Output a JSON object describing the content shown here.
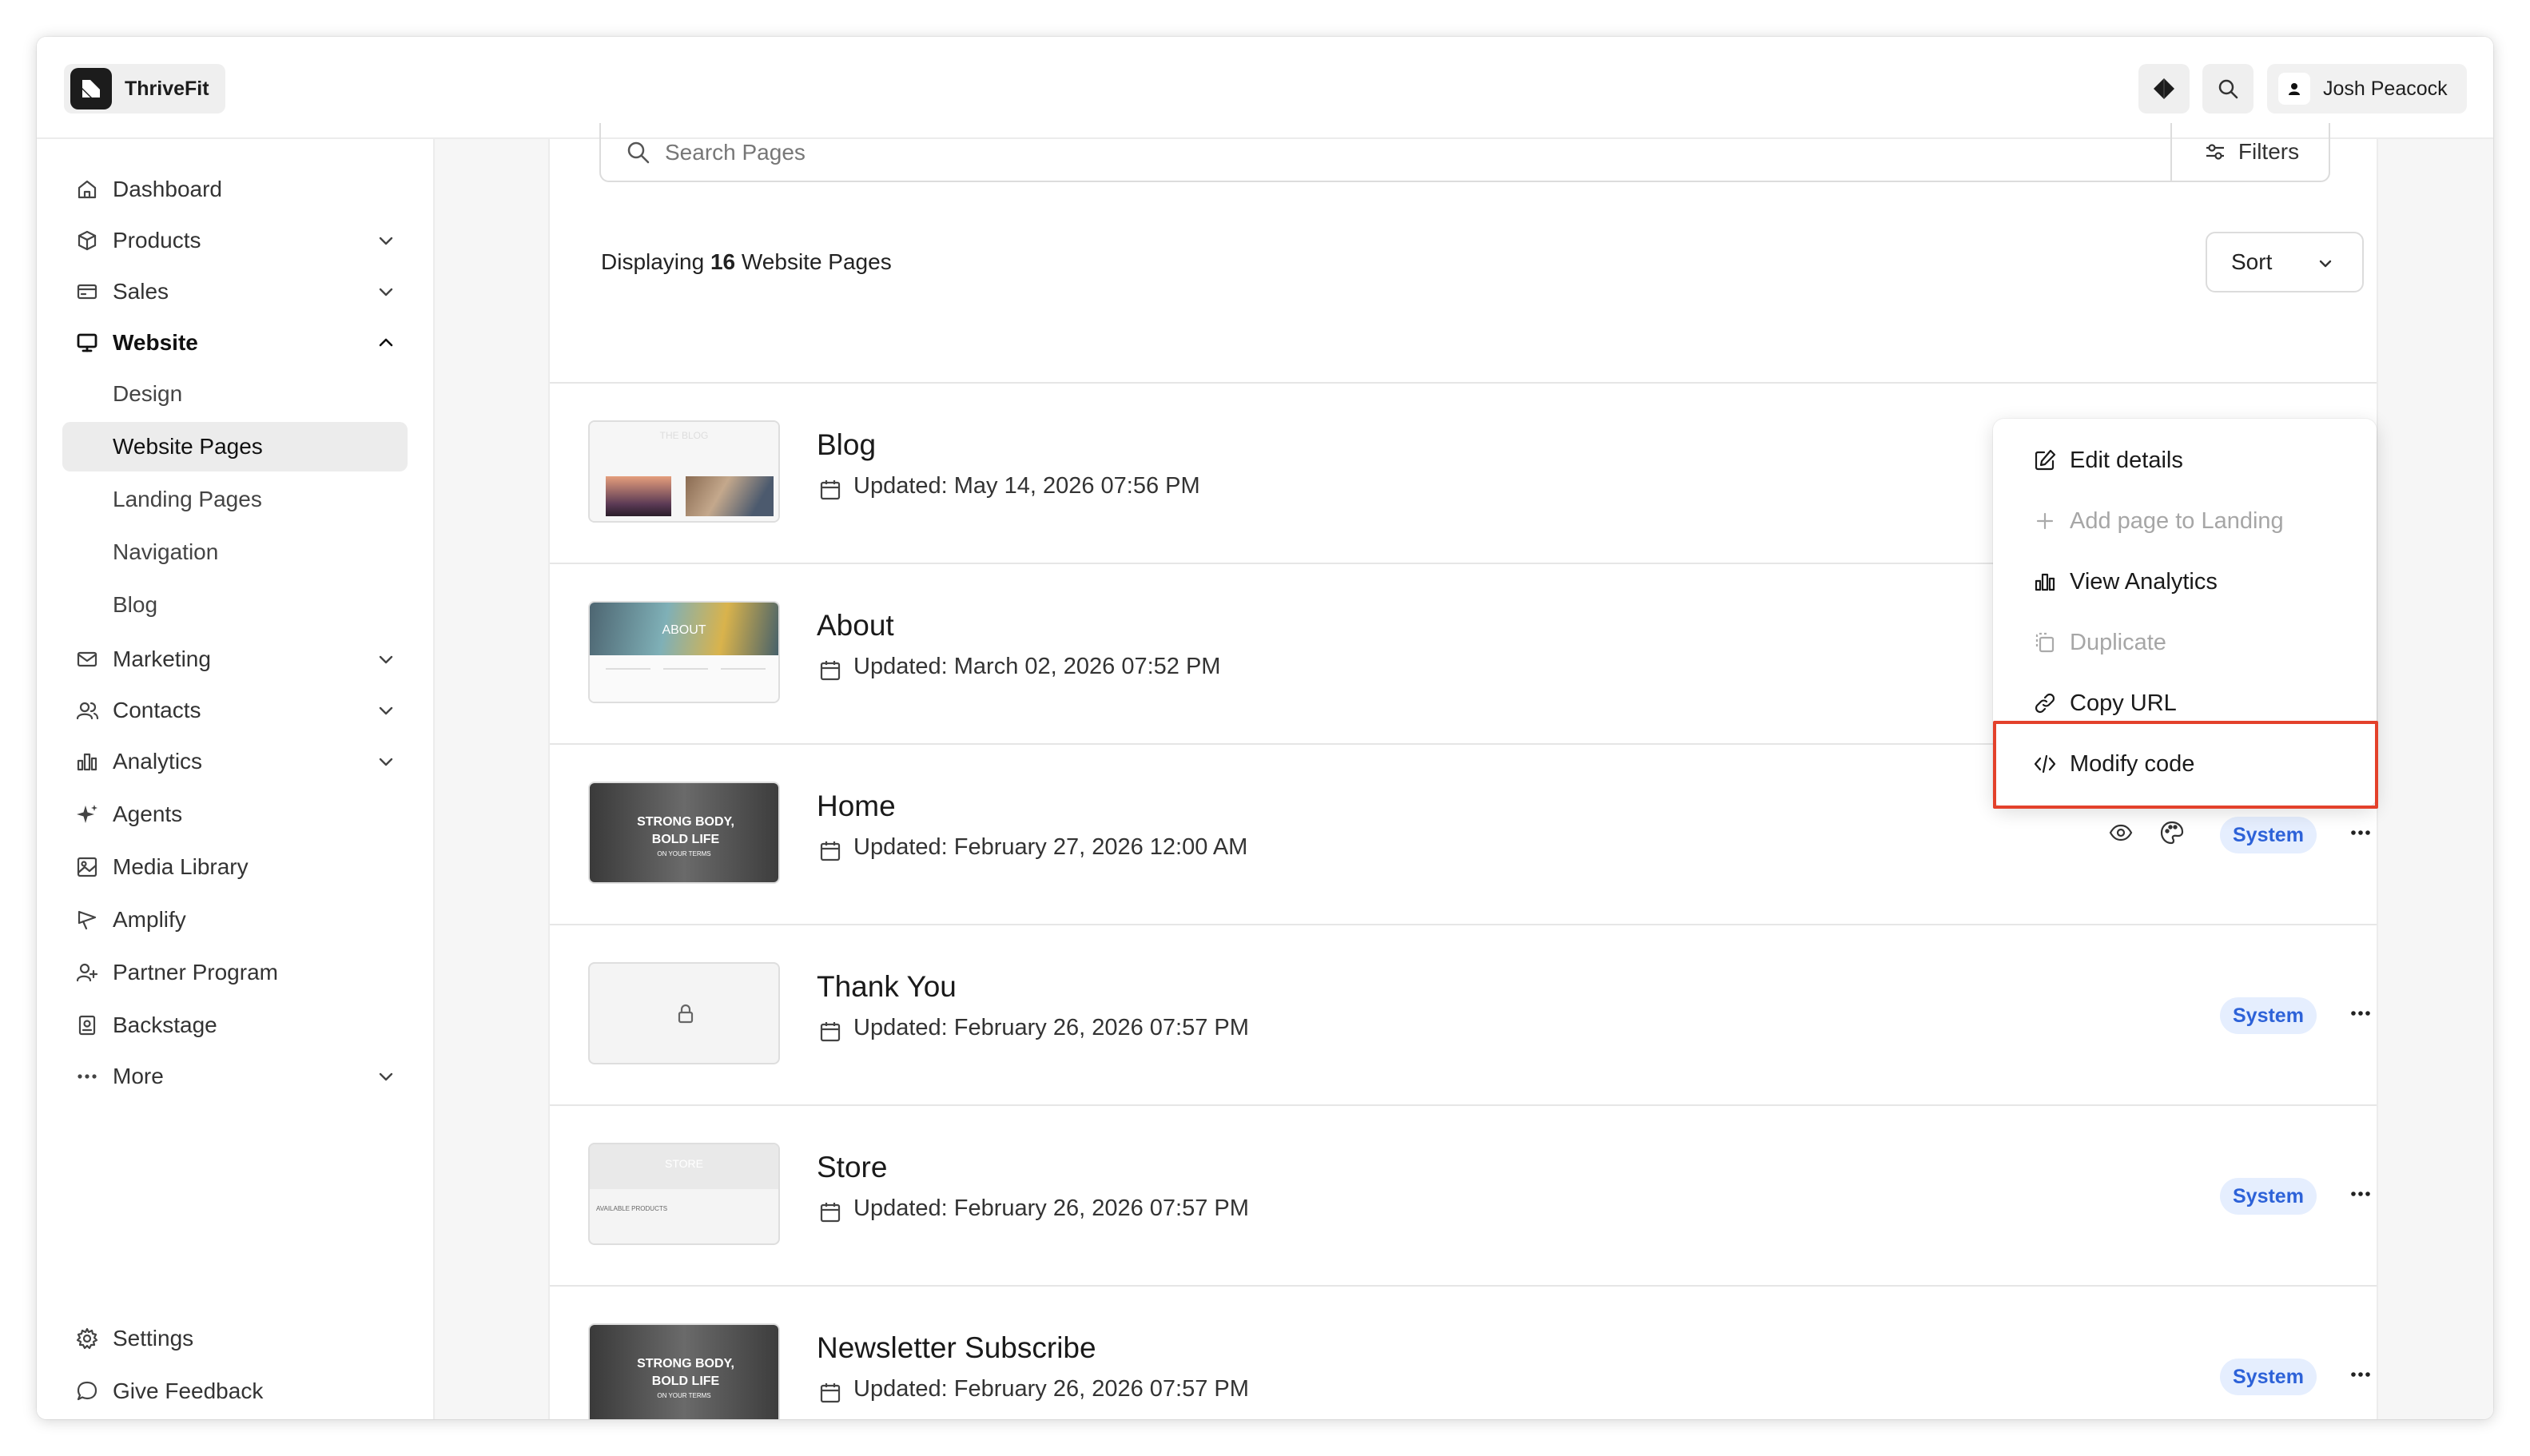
{
  "app": {
    "name": "ThriveFit"
  },
  "header": {
    "user_name": "Josh Peacock",
    "icons": [
      "diamond-icon",
      "search-icon",
      "user-icon"
    ]
  },
  "sidebar": {
    "items": [
      {
        "label": "Dashboard",
        "icon": "home-icon"
      },
      {
        "label": "Products",
        "icon": "box-icon"
      },
      {
        "label": "Sales",
        "icon": "credit-card-icon"
      },
      {
        "label": "Website",
        "icon": "monitor-icon"
      },
      {
        "label": "Marketing",
        "icon": "mail-icon"
      },
      {
        "label": "Contacts",
        "icon": "users-icon"
      },
      {
        "label": "Analytics",
        "icon": "bar-chart-icon"
      },
      {
        "label": "Agents",
        "icon": "sparkle-icon"
      },
      {
        "label": "Media Library",
        "icon": "image-icon"
      },
      {
        "label": "Amplify",
        "icon": "megaphone-icon"
      },
      {
        "label": "Partner Program",
        "icon": "user-plus-icon"
      },
      {
        "label": "Backstage",
        "icon": "badge-icon"
      },
      {
        "label": "More",
        "icon": "ellipsis-icon"
      }
    ],
    "website_sub": [
      "Design",
      "Website Pages",
      "Landing Pages",
      "Navigation",
      "Blog"
    ],
    "footer": [
      {
        "label": "Settings",
        "icon": "gear-icon"
      },
      {
        "label": "Give Feedback",
        "icon": "chat-icon"
      }
    ]
  },
  "main": {
    "search_placeholder": "Search Pages",
    "filters_label": "Filters",
    "count_prefix": "Displaying ",
    "count_value": "16",
    "count_suffix": " Website Pages",
    "sort_label": "Sort",
    "rows": [
      {
        "title": "Blog",
        "updated": "Updated: May 14, 2026 07:56 PM",
        "thumb_text": "THE BLOG"
      },
      {
        "title": "About",
        "updated": "Updated: March 02, 2026 07:52 PM",
        "thumb_text": "ABOUT"
      },
      {
        "title": "Home",
        "updated": "Updated: February 27, 2026 12:00 AM",
        "thumb_text": "STRONG BODY, BOLD LIFE",
        "thumb_sub": "ON YOUR TERMS",
        "badge": "System"
      },
      {
        "title": "Thank You",
        "updated": "Updated: February 26, 2026 07:57 PM",
        "badge": "System"
      },
      {
        "title": "Store",
        "updated": "Updated: February 26, 2026 07:57 PM",
        "thumb_text": "STORE",
        "thumb_sub": "AVAILABLE PRODUCTS",
        "badge": "System"
      },
      {
        "title": "Newsletter Subscribe",
        "updated": "Updated: February 26, 2026 07:57 PM",
        "thumb_text": "STRONG BODY, BOLD LIFE",
        "thumb_sub": "ON YOUR TERMS",
        "badge": "System"
      }
    ]
  },
  "menu": {
    "items": [
      {
        "label": "Edit details",
        "icon": "edit-icon",
        "disabled": false
      },
      {
        "label": "Add page to Landing",
        "icon": "plus-icon",
        "disabled": true
      },
      {
        "label": "View Analytics",
        "icon": "bar-chart-icon",
        "disabled": false
      },
      {
        "label": "Duplicate",
        "icon": "copy-icon",
        "disabled": true
      },
      {
        "label": "Copy URL",
        "icon": "link-icon",
        "disabled": false
      },
      {
        "label": "Modify code",
        "icon": "code-icon",
        "disabled": false
      }
    ]
  },
  "colors": {
    "badge_bg": "#e5eefe",
    "badge_text": "#2d62d8",
    "highlight": "#e3412b"
  }
}
